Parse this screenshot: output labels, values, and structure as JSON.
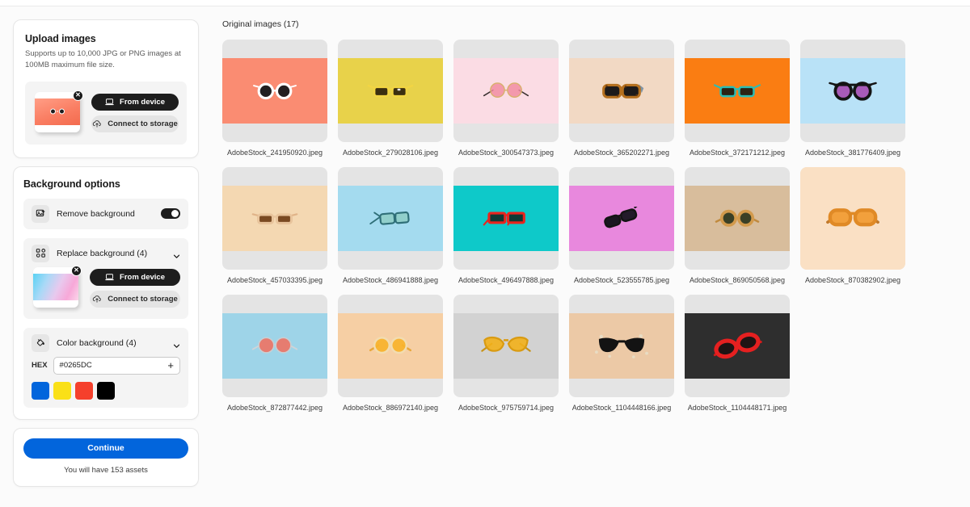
{
  "upload": {
    "title": "Upload images",
    "subtitle": "Supports up to 10,000 JPG or PNG images at 100MB maximum file size.",
    "from_device_label": "From device",
    "connect_storage_label": "Connect to storage",
    "remove_thumb_label": "✕"
  },
  "background": {
    "title": "Background options",
    "remove": {
      "label": "Remove background",
      "enabled": true
    },
    "replace": {
      "label": "Replace background (4)",
      "from_device_label": "From device",
      "connect_storage_label": "Connect to storage",
      "remove_thumb_label": "✕"
    },
    "color": {
      "label": "Color background (4)",
      "hex_label": "HEX",
      "hex_value": "#0265DC",
      "add_label": "+",
      "swatches": [
        "#0265DC",
        "#FAE017",
        "#F5402C",
        "#000000"
      ]
    }
  },
  "footer": {
    "continue_label": "Continue",
    "assets_note": "You will have 153 assets"
  },
  "main": {
    "title": "Original images (17)",
    "images": [
      {
        "name": "AdobeStock_241950920.jpeg",
        "bg": "#fa8c72",
        "fit": "wide",
        "style": "white-round"
      },
      {
        "name": "AdobeStock_279028106.jpeg",
        "bg": "#e8d24a",
        "fit": "wide",
        "style": "yellow-wayfarer"
      },
      {
        "name": "AdobeStock_300547373.jpeg",
        "bg": "#fbdce4",
        "fit": "wide",
        "style": "pink-round-thin"
      },
      {
        "name": "AdobeStock_365202271.jpeg",
        "bg": "#f2d9c4",
        "fit": "wide",
        "style": "tortoise"
      },
      {
        "name": "AdobeStock_372171212.jpeg",
        "bg": "#fa7d12",
        "fit": "wide",
        "style": "teal-wayfarer"
      },
      {
        "name": "AdobeStock_381776409.jpeg",
        "bg": "#b9e2f7",
        "fit": "wide",
        "style": "black-purple"
      },
      {
        "name": "AdobeStock_457033395.jpeg",
        "bg": "#f4d8b2",
        "fit": "wide",
        "style": "tan-square"
      },
      {
        "name": "AdobeStock_486941888.jpeg",
        "bg": "#a4dbef",
        "fit": "wide",
        "style": "teal-angled"
      },
      {
        "name": "AdobeStock_496497888.jpeg",
        "bg": "#0ec9c9",
        "fit": "wide",
        "style": "red-square"
      },
      {
        "name": "AdobeStock_523555785.jpeg",
        "bg": "#e888dd",
        "fit": "wide",
        "style": "black-tilt"
      },
      {
        "name": "AdobeStock_869050568.jpeg",
        "bg": "#d8bd9c",
        "fit": "wide",
        "style": "olive-round"
      },
      {
        "name": "AdobeStock_870382902.jpeg",
        "bg": "#fae0c4",
        "fit": "full",
        "style": "orange-big"
      },
      {
        "name": "AdobeStock_872877442.jpeg",
        "bg": "#9ed4e8",
        "fit": "wide",
        "style": "coral-round"
      },
      {
        "name": "AdobeStock_886972140.jpeg",
        "bg": "#f6cfa4",
        "fit": "wide",
        "style": "amber-round"
      },
      {
        "name": "AdobeStock_975759714.jpeg",
        "bg": "#d2d2d2",
        "fit": "wide",
        "style": "yellow-cat"
      },
      {
        "name": "AdobeStock_1104448166.jpeg",
        "bg": "#ecc9a6",
        "fit": "wide",
        "style": "black-cat-pearls"
      },
      {
        "name": "AdobeStock_1104448171.jpeg",
        "bg": "#2e2e2e",
        "fit": "wide",
        "style": "red-oval"
      }
    ]
  }
}
